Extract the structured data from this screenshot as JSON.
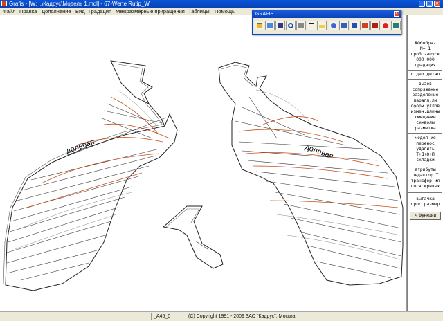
{
  "window": {
    "title": "Grafis - [W: ..\\Кадрус\\Модель 1.mdl] - 67-Werte Rutip_W",
    "minimize_icon": "minimize-icon",
    "maximize_icon": "maximize-icon",
    "close_icon": "close-icon"
  },
  "menu": {
    "items": [
      "Файл",
      "Правка",
      "Дополнение",
      "Вид",
      "Градация",
      "Межразмерные приращения",
      "Таблицы",
      "Помощь"
    ]
  },
  "toolbox": {
    "title": "GRAFIS",
    "tools": [
      "open-folder-icon",
      "edit-icon",
      "save-icon",
      "search-icon",
      "print-icon",
      "layers-icon",
      "ruler-icon",
      "target-icon",
      "cut-icon",
      "z-icon",
      "export-down-icon",
      "import-icon",
      "stop-icon",
      "monitor-icon"
    ]
  },
  "canvas": {
    "piece_label_left": "долевая",
    "piece_label_right": "долевая"
  },
  "panel": {
    "lines_top": [
      "№Обобраз",
      "N=   1",
      "проб запуск",
      "000 000",
      "градация"
    ],
    "line_det": "отдел.детал",
    "lines_functions": [
      "вызов",
      "сопряжение",
      "разделение",
      "паралл.ли",
      "оформ.углов",
      "измен.длины",
      "смещение",
      "символы",
      "разметка"
    ],
    "lines_model": [
      "модел-ие",
      "перенос",
      "удалить",
      "Т+Д+О+П",
      "складки"
    ],
    "lines_attr": [
      "атрибуты",
      "редактор Т",
      "трансфор-ия",
      "посв.кривых"
    ],
    "lines_end": [
      "вытачка",
      "прос.размер"
    ],
    "functions_button": "< Функции"
  },
  "status": {
    "cell1": "",
    "cell2": "_A46_0",
    "cell3": "(C) Copyright 1991 - 2009 ЗАО \"Кадрус\", Москва"
  }
}
